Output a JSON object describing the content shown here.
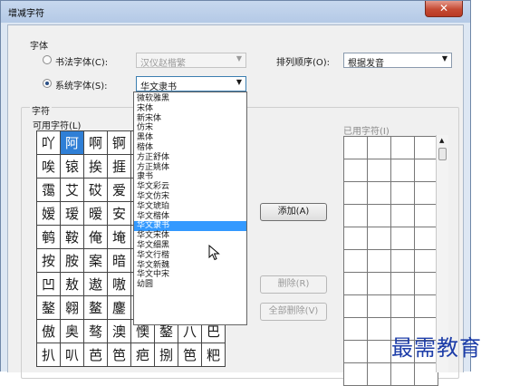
{
  "window": {
    "title": "增减字符",
    "close_glyph": "✕"
  },
  "font_group": {
    "label": "字体",
    "calligraphy_font_label": "书法字体(C):",
    "calligraphy_font_value": "汉仪赵楷繁",
    "system_font_label": "系统字体(S):",
    "system_font_value": "华文隶书",
    "selected_radio": "system",
    "sort_label": "排列顺序(O):",
    "sort_value": "根据发音"
  },
  "chars_group": {
    "label": "字符",
    "available_label": "可用字符(L)",
    "used_label": "已用字符(I)",
    "selected_char": "阿",
    "available_rows": [
      [
        "吖",
        "阿",
        "啊",
        "锕",
        "",
        "",
        "",
        ""
      ],
      [
        "唉",
        "锿",
        "挨",
        "捱",
        "",
        "",
        "",
        ""
      ],
      [
        "霭",
        "艾",
        "砹",
        "爱",
        "",
        "",
        "",
        ""
      ],
      [
        "嫒",
        "瑷",
        "暧",
        "安",
        "",
        "",
        "",
        ""
      ],
      [
        "鹌",
        "鞍",
        "俺",
        "埯",
        "",
        "",
        "",
        ""
      ],
      [
        "按",
        "胺",
        "案",
        "暗",
        "",
        "",
        "",
        ""
      ],
      [
        "凹",
        "敖",
        "遨",
        "嗷",
        "",
        "",
        "",
        ""
      ],
      [
        "鏊",
        "翱",
        "鳌",
        "鏖",
        "",
        "",
        "",
        ""
      ],
      [
        "傲",
        "奥",
        "骜",
        "澳",
        "懊",
        "鏊",
        "八",
        "巴"
      ],
      [
        "扒",
        "叭",
        "芭",
        "笆",
        "疤",
        "捌",
        "笆",
        "粑"
      ]
    ]
  },
  "buttons": {
    "add": "添加(A)",
    "delete": "删除(R)",
    "delete_all": "全部删除(V)"
  },
  "font_dropdown": {
    "items": [
      "微软雅黑",
      "宋体",
      "新宋体",
      "仿宋",
      "黑体",
      "楷体",
      "方正舒体",
      "方正姚体",
      "隶书",
      "华文彩云",
      "华文仿宋",
      "华文琥珀",
      "华文楷体",
      "华文隶书",
      "华文宋体",
      "华文细黑",
      "华文行楷",
      "华文新魏",
      "华文中宋",
      "幼圆"
    ],
    "highlighted_index": 13
  },
  "watermark": "最需教育",
  "colors": {
    "selection_blue": "#3399ff",
    "grid_selection": "#2f7fd6",
    "close_red": "#c54a33",
    "watermark_blue": "#1d3da8"
  }
}
